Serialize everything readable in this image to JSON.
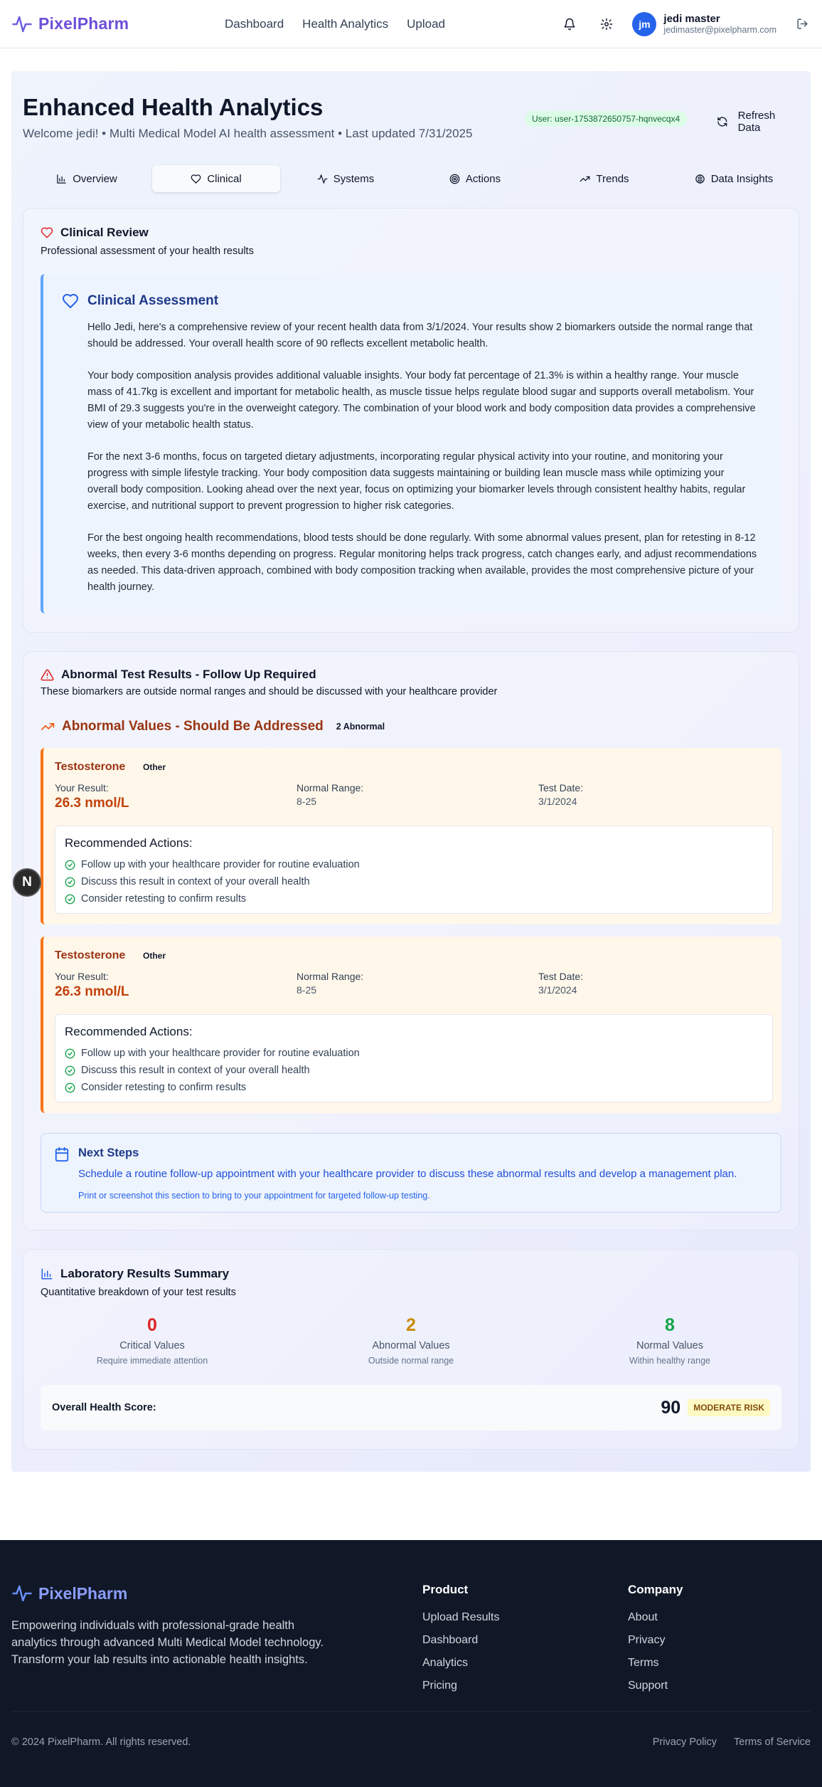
{
  "nav": {
    "brand": "PixelPharm",
    "links": [
      "Dashboard",
      "Health Analytics",
      "Upload"
    ],
    "avatar_initials": "jm",
    "user_name": "jedi master",
    "user_email": "jedimaster@pixelpharm.com"
  },
  "header": {
    "title": "Enhanced Health Analytics",
    "subtitle": "Welcome jedi! • Multi Medical Model AI health assessment • Last updated 7/31/2025",
    "user_badge": "User: user-1753872650757-hqnvecqx4",
    "refresh_label": "Refresh Data"
  },
  "tabs": [
    {
      "label": "Overview",
      "icon": "bar-chart-icon"
    },
    {
      "label": "Clinical",
      "icon": "heart-icon",
      "active": true
    },
    {
      "label": "Systems",
      "icon": "activity-icon"
    },
    {
      "label": "Actions",
      "icon": "target-icon"
    },
    {
      "label": "Trends",
      "icon": "trending-up-icon"
    },
    {
      "label": "Data Insights",
      "icon": "brain-icon"
    }
  ],
  "clinical": {
    "title": "Clinical Review",
    "subtitle": "Professional assessment of your health results",
    "assessment_title": "Clinical Assessment",
    "paragraphs": [
      "Hello Jedi, here's a comprehensive review of your recent health data from 3/1/2024. Your results show 2 biomarkers outside the normal range that should be addressed. Your overall health score of 90 reflects excellent metabolic health.",
      "Your body composition analysis provides additional valuable insights. Your body fat percentage of 21.3% is within a healthy range. Your muscle mass of 41.7kg is excellent and important for metabolic health, as muscle tissue helps regulate blood sugar and supports overall metabolism. Your BMI of 29.3 suggests you're in the overweight category. The combination of your blood work and body composition data provides a comprehensive view of your metabolic health status.",
      "For the next 3-6 months, focus on targeted dietary adjustments, incorporating regular physical activity into your routine, and monitoring your progress with simple lifestyle tracking. Your body composition data suggests maintaining or building lean muscle mass while optimizing your overall body composition. Looking ahead over the next year, focus on optimizing your biomarker levels through consistent healthy habits, regular exercise, and nutritional support to prevent progression to higher risk categories.",
      "For the best ongoing health recommendations, blood tests should be done regularly. With some abnormal values present, plan for retesting in 8-12 weeks, then every 3-6 months depending on progress. Regular monitoring helps track progress, catch changes early, and adjust recommendations as needed. This data-driven approach, combined with body composition tracking when available, provides the most comprehensive picture of your health journey."
    ]
  },
  "abnormal": {
    "title": "Abnormal Test Results - Follow Up Required",
    "subtitle": "These biomarkers are outside normal ranges and should be discussed with your healthcare provider",
    "section_title": "Abnormal Values - Should Be Addressed",
    "count_badge": "2 Abnormal",
    "result_label": "Your Result:",
    "range_label": "Normal Range:",
    "date_label": "Test Date:",
    "rec_title": "Recommended Actions:",
    "tests": [
      {
        "name": "Testosterone",
        "tag": "Other",
        "result": "26.3 nmol/L",
        "range": "8-25",
        "date": "3/1/2024",
        "actions": [
          "Follow up with your healthcare provider for routine evaluation",
          "Discuss this result in context of your overall health",
          "Consider retesting to confirm results"
        ]
      },
      {
        "name": "Testosterone",
        "tag": "Other",
        "result": "26.3 nmol/L",
        "range": "8-25",
        "date": "3/1/2024",
        "actions": [
          "Follow up with your healthcare provider for routine evaluation",
          "Discuss this result in context of your overall health",
          "Consider retesting to confirm results"
        ]
      }
    ],
    "next_steps": {
      "title": "Next Steps",
      "text": "Schedule a routine follow-up appointment with your healthcare provider to discuss these abnormal results and develop a management plan.",
      "note": "Print or screenshot this section to bring to your appointment for targeted follow-up testing."
    }
  },
  "lab": {
    "title": "Laboratory Results Summary",
    "subtitle": "Quantitative breakdown of your test results",
    "stats": [
      {
        "value": "0",
        "name": "Critical Values",
        "desc": "Require immediate attention",
        "color": "#dc2626"
      },
      {
        "value": "2",
        "name": "Abnormal Values",
        "desc": "Outside normal range",
        "color": "#ca8a04"
      },
      {
        "value": "8",
        "name": "Normal Values",
        "desc": "Within healthy range",
        "color": "#16a34a"
      }
    ],
    "score_label": "Overall Health Score:",
    "score_value": "90",
    "risk_label": "MODERATE RISK"
  },
  "fab_label": "N",
  "footer": {
    "brand": "PixelPharm",
    "description": "Empowering individuals with professional-grade health analytics through advanced Multi Medical Model technology. Transform your lab results into actionable health insights.",
    "product_title": "Product",
    "product_links": [
      "Upload Results",
      "Dashboard",
      "Analytics",
      "Pricing"
    ],
    "company_title": "Company",
    "company_links": [
      "About",
      "Privacy",
      "Terms",
      "Support"
    ],
    "copyright": "© 2024 PixelPharm. All rights reserved.",
    "legal_links": [
      "Privacy Policy",
      "Terms of Service"
    ]
  }
}
